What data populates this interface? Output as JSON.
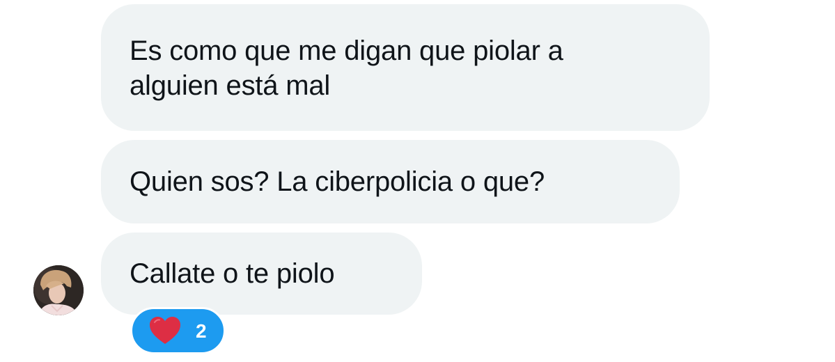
{
  "messages": [
    {
      "text": "Es como que me digan que piolar a\nalguien está mal"
    },
    {
      "text": "Quien sos? La ciberpolicia o que?"
    },
    {
      "text": "Callate o te piolo"
    }
  ],
  "reaction": {
    "emoji_icon": "red-heart-icon",
    "count": "2",
    "color": "#1d9bf0"
  },
  "colors": {
    "bubble": "#eff3f4",
    "text": "#0f1419",
    "heart": "#dd2e44"
  }
}
